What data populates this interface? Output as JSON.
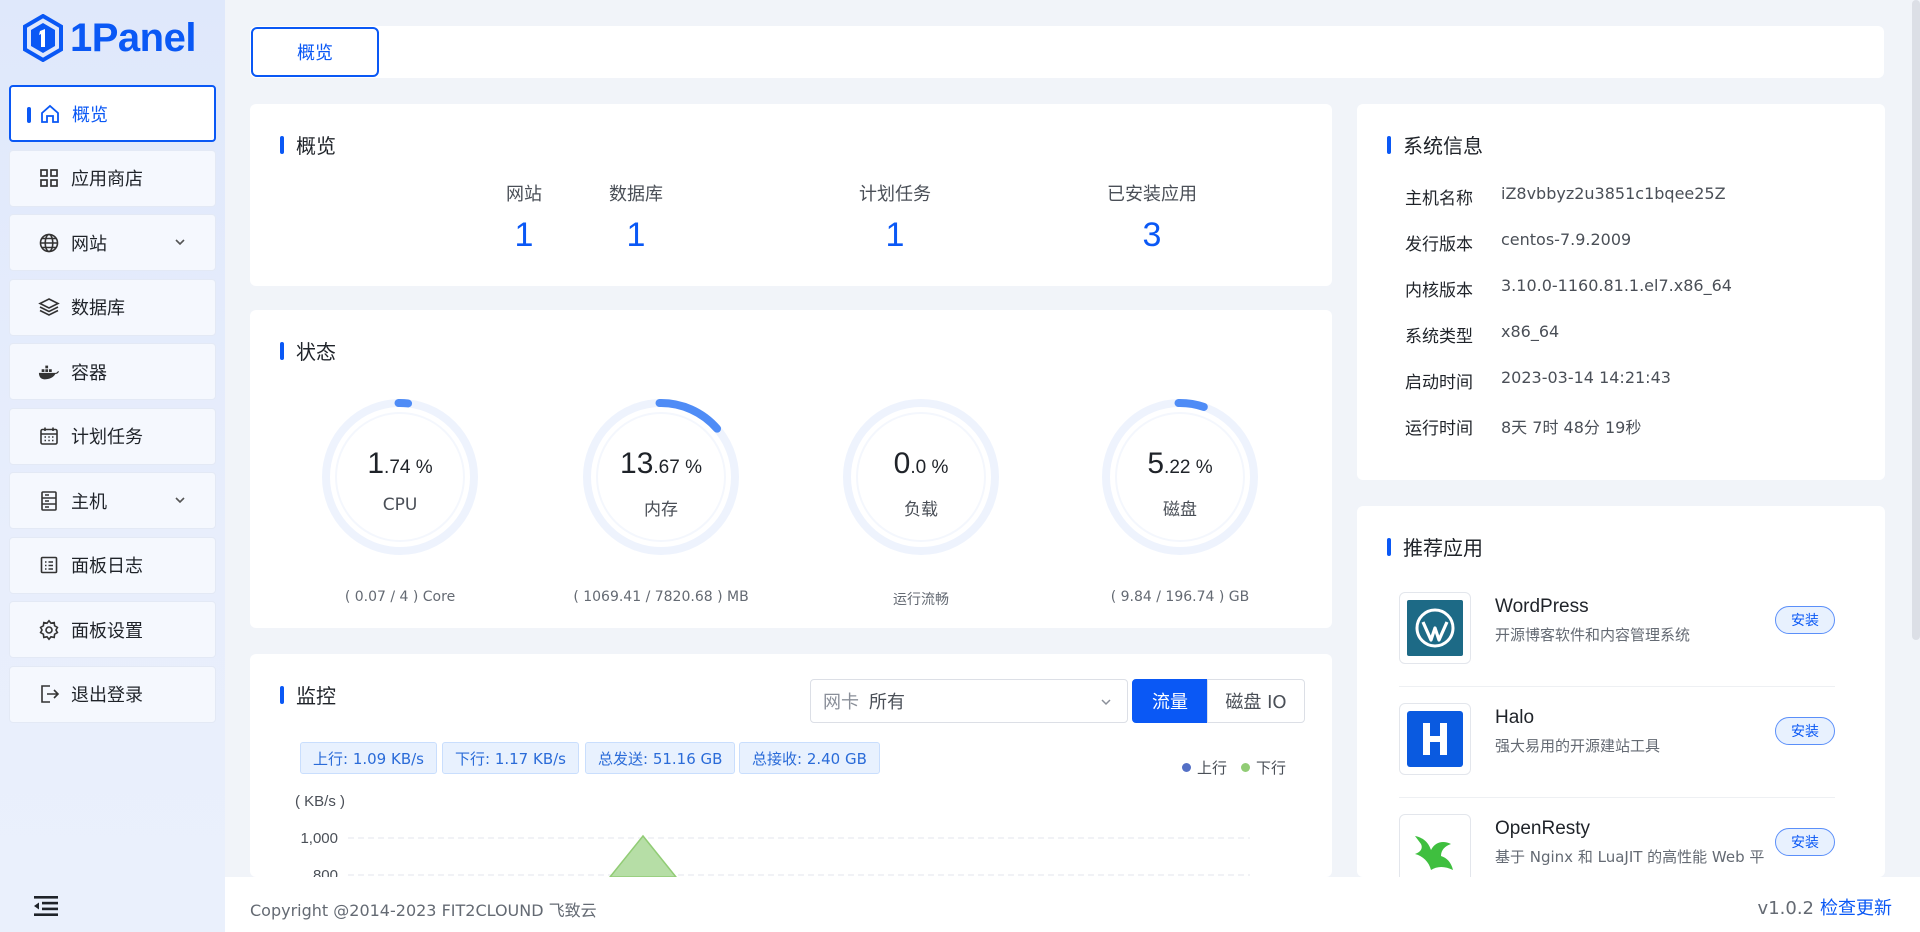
{
  "brand": {
    "name": "1Panel"
  },
  "sidebar": {
    "items": [
      {
        "label": "概览",
        "icon": "home-icon",
        "active": true
      },
      {
        "label": "应用商店",
        "icon": "grid-icon"
      },
      {
        "label": "网站",
        "icon": "globe-icon",
        "expandable": true
      },
      {
        "label": "数据库",
        "icon": "layers-icon"
      },
      {
        "label": "容器",
        "icon": "docker-icon"
      },
      {
        "label": "计划任务",
        "icon": "calendar-icon"
      },
      {
        "label": "主机",
        "icon": "server-icon",
        "expandable": true
      },
      {
        "label": "面板日志",
        "icon": "log-icon"
      },
      {
        "label": "面板设置",
        "icon": "gear-icon"
      },
      {
        "label": "退出登录",
        "icon": "logout-icon"
      }
    ]
  },
  "tabs": [
    {
      "label": "概览"
    }
  ],
  "overview": {
    "title": "概览",
    "items": [
      {
        "label": "网站",
        "value": "1"
      },
      {
        "label": "数据库",
        "value": "1"
      },
      {
        "label": "计划任务",
        "value": "1"
      },
      {
        "label": "已安装应用",
        "value": "3"
      }
    ]
  },
  "status": {
    "title": "状态",
    "gauges": [
      {
        "int": "1",
        "dec": ".74 %",
        "label": "CPU",
        "detail": "( 0.07 / 4 ) Core",
        "percent": 1.74
      },
      {
        "int": "13",
        "dec": ".67 %",
        "label": "内存",
        "detail": "( 1069.41 / 7820.68 ) MB",
        "percent": 13.67
      },
      {
        "int": "0",
        "dec": ".0 %",
        "label": "负载",
        "detail": "运行流畅",
        "percent": 0
      },
      {
        "int": "5",
        "dec": ".22 %",
        "label": "磁盘",
        "detail": "( 9.84 / 196.74 ) GB",
        "percent": 5.22
      }
    ]
  },
  "monitor": {
    "title": "监控",
    "nic_prefix": "网卡",
    "nic_value": "所有",
    "segments": [
      "流量",
      "磁盘 IO"
    ],
    "stats": [
      "上行: 1.09 KB/s",
      "下行: 1.17 KB/s",
      "总发送: 51.16 GB",
      "总接收: 2.40 GB"
    ],
    "legend": [
      {
        "label": "上行",
        "color": "#5470c6"
      },
      {
        "label": "下行",
        "color": "#91cc75"
      }
    ]
  },
  "chart_data": {
    "type": "area",
    "ylabel": "( KB/s )",
    "yticks": [
      "1,000",
      "800"
    ],
    "series": [
      {
        "name": "上行",
        "color": "#5470c6"
      },
      {
        "name": "下行",
        "color": "#91cc75"
      }
    ]
  },
  "system_info": {
    "title": "系统信息",
    "rows": [
      {
        "key": "主机名称",
        "value": "iZ8vbbyz2u3851c1bqee25Z"
      },
      {
        "key": "发行版本",
        "value": "centos-7.9.2009"
      },
      {
        "key": "内核版本",
        "value": "3.10.0-1160.81.1.el7.x86_64"
      },
      {
        "key": "系统类型",
        "value": "x86_64"
      },
      {
        "key": "启动时间",
        "value": "2023-03-14 14:21:43"
      },
      {
        "key": "运行时间",
        "value": "8天 7时 48分 19秒"
      }
    ]
  },
  "recommended": {
    "title": "推荐应用",
    "install_label": "安装",
    "apps": [
      {
        "name": "WordPress",
        "desc": "开源博客软件和内容管理系统",
        "icon": "wordpress-icon"
      },
      {
        "name": "Halo",
        "desc": "强大易用的开源建站工具",
        "icon": "halo-icon"
      },
      {
        "name": "OpenResty",
        "desc": "基于 Nginx 和 LuaJIT 的高性能 Web 平",
        "icon": "openresty-icon"
      }
    ]
  },
  "footer": {
    "copyright": "Copyright @2014-2023 FIT2CLOUND 飞致云",
    "version": "v1.0.2",
    "update_link": "检查更新"
  },
  "colors": {
    "accent": "#0a58f5"
  }
}
